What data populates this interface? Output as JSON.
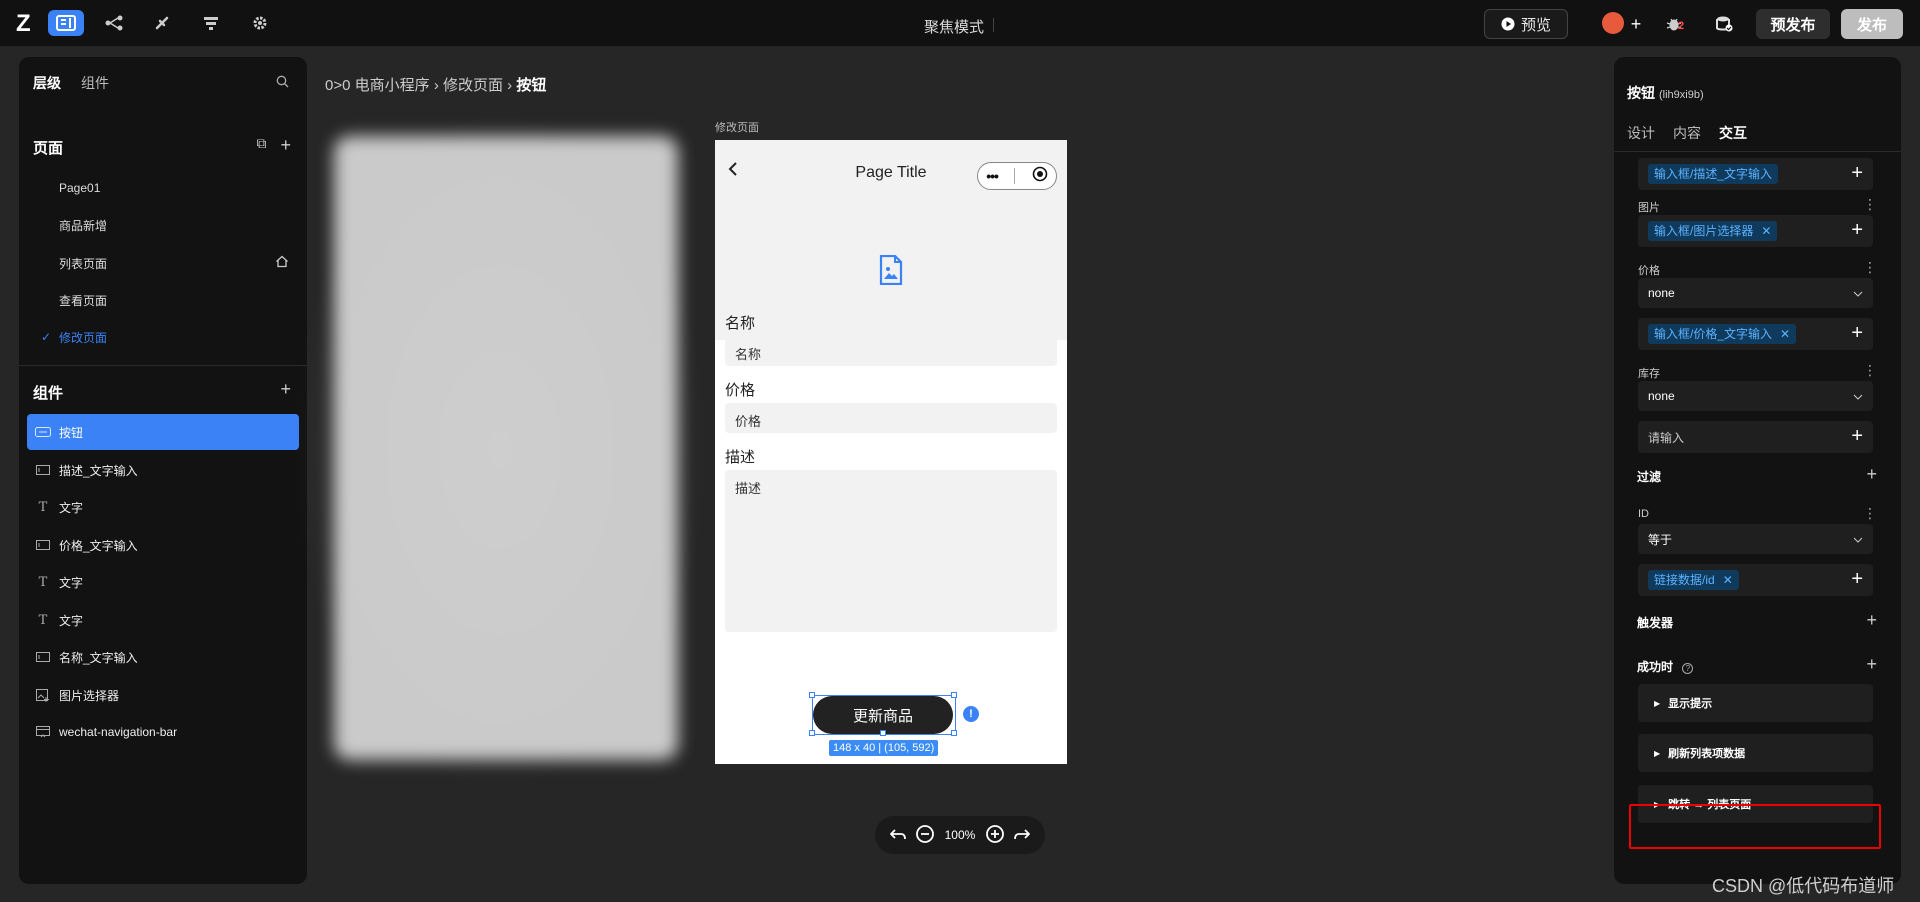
{
  "topbar": {
    "logo": "Z",
    "focus_mode": "聚焦模式",
    "preview_label": "预览",
    "prepublish_label": "预发布",
    "publish_label": "发布",
    "badge_count": "2",
    "icons": [
      "pages-icon",
      "flow-icon",
      "plugin-icon",
      "data-icon",
      "settings-icon"
    ]
  },
  "left": {
    "tabs": [
      "层级",
      "组件"
    ],
    "pages_title": "页面",
    "pages": [
      "Page01",
      "商品新增",
      "列表页面",
      "查看页面",
      "修改页面"
    ],
    "components_title": "组件",
    "components": [
      "按钮",
      "描述_文字输入",
      "文字",
      "价格_文字输入",
      "文字",
      "文字",
      "名称_文字输入",
      "图片选择器",
      "wechat-navigation-bar"
    ]
  },
  "breadcrumb": {
    "prefix": "0>0",
    "app": "电商小程序",
    "page": "修改页面",
    "current": "按钮",
    "sep": "›"
  },
  "canvas": {
    "label": "修改页面",
    "nav_title": "Page Title",
    "fields": [
      {
        "label": "名称",
        "placeholder": "名称"
      },
      {
        "label": "价格",
        "placeholder": "价格"
      },
      {
        "label": "描述",
        "placeholder": "描述"
      }
    ],
    "submit_label": "更新商品",
    "size_badge": "148 x 40 | (105, 592)",
    "zoom": "100%"
  },
  "right": {
    "title": "按钮",
    "subtitle": "(lih9xi9b)",
    "tabs": [
      "设计",
      "内容",
      "交互"
    ],
    "rows": {
      "chip_desc": "输入框/描述_文字输入",
      "label_image": "图片",
      "chip_image": "输入框/图片选择器",
      "label_price": "价格",
      "select_price": "none",
      "chip_price": "输入框/价格_文字输入",
      "label_stock": "库存",
      "select_stock": "none",
      "stock_placeholder": "请输入",
      "filter": "过滤",
      "label_id": "ID",
      "select_id": "等于",
      "chip_id": "链接数据/id",
      "trigger": "触发器",
      "on_success": "成功时",
      "actions": [
        "显示提示",
        "刷新列表项数据",
        "跳转 → 列表页面"
      ]
    }
  },
  "watermark": "CSDN @低代码布道师",
  "colors": {
    "accent": "#3b82f6",
    "highlight": "#e00000"
  }
}
